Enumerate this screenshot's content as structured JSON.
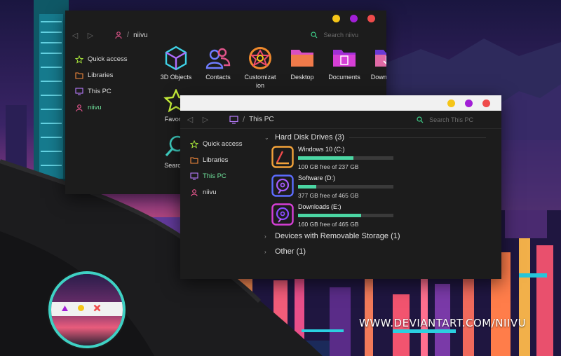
{
  "colors": {
    "accent_green": "#6fe09a",
    "bar_fill": "#4bd6a3",
    "dot_yellow": "#f5c518",
    "dot_purple": "#a21fd6",
    "dot_red": "#ef4b4b"
  },
  "back_window": {
    "path_label": "niivu",
    "search_placeholder": "Search niivu",
    "sidebar": [
      {
        "label": "Quick access",
        "icon": "star-icon"
      },
      {
        "label": "Libraries",
        "icon": "folder-icon"
      },
      {
        "label": "This PC",
        "icon": "monitor-icon"
      },
      {
        "label": "niivu",
        "icon": "user-icon",
        "active": true
      }
    ],
    "icons": [
      {
        "label": "3D Objects",
        "icon": "cube-icon"
      },
      {
        "label": "Contacts",
        "icon": "contacts-icon"
      },
      {
        "label": "Customizat\nion",
        "icon": "palette-icon"
      },
      {
        "label": "Desktop",
        "icon": "desktop-folder-icon"
      },
      {
        "label": "Documents",
        "icon": "documents-folder-icon"
      },
      {
        "label": "Downloads",
        "icon": "downloads-folder-icon"
      }
    ],
    "icons_row2": [
      {
        "label": "Favorite",
        "icon": "favorites-star-icon"
      },
      {
        "label": "Searche",
        "icon": "searches-magnifier-icon"
      }
    ]
  },
  "front_window": {
    "path_label": "This PC",
    "search_placeholder": "Search This PC",
    "sidebar": [
      {
        "label": "Quick access",
        "icon": "star-icon"
      },
      {
        "label": "Libraries",
        "icon": "folder-icon"
      },
      {
        "label": "This PC",
        "icon": "monitor-icon",
        "active": true
      },
      {
        "label": "niivu",
        "icon": "user-icon"
      }
    ],
    "sections": {
      "hdd": "Hard Disk Drives (3)",
      "removable": "Devices with Removable Storage (1)",
      "other": "Other (1)"
    },
    "drives": [
      {
        "name": "Windows 10 (C:)",
        "free_text": "100 GB free of 237 GB",
        "used_fraction": 0.58,
        "icon": "windows-drive-icon"
      },
      {
        "name": "Software (D:)",
        "free_text": "377 GB free of 465 GB",
        "used_fraction": 0.19,
        "icon": "hard-disk-icon"
      },
      {
        "name": "Downloads (E:)",
        "free_text": "160 GB free of 465 GB",
        "used_fraction": 0.66,
        "icon": "hard-disk-icon"
      }
    ]
  },
  "watermark": "WWW.DEVIANTART.COM/NIIVU"
}
